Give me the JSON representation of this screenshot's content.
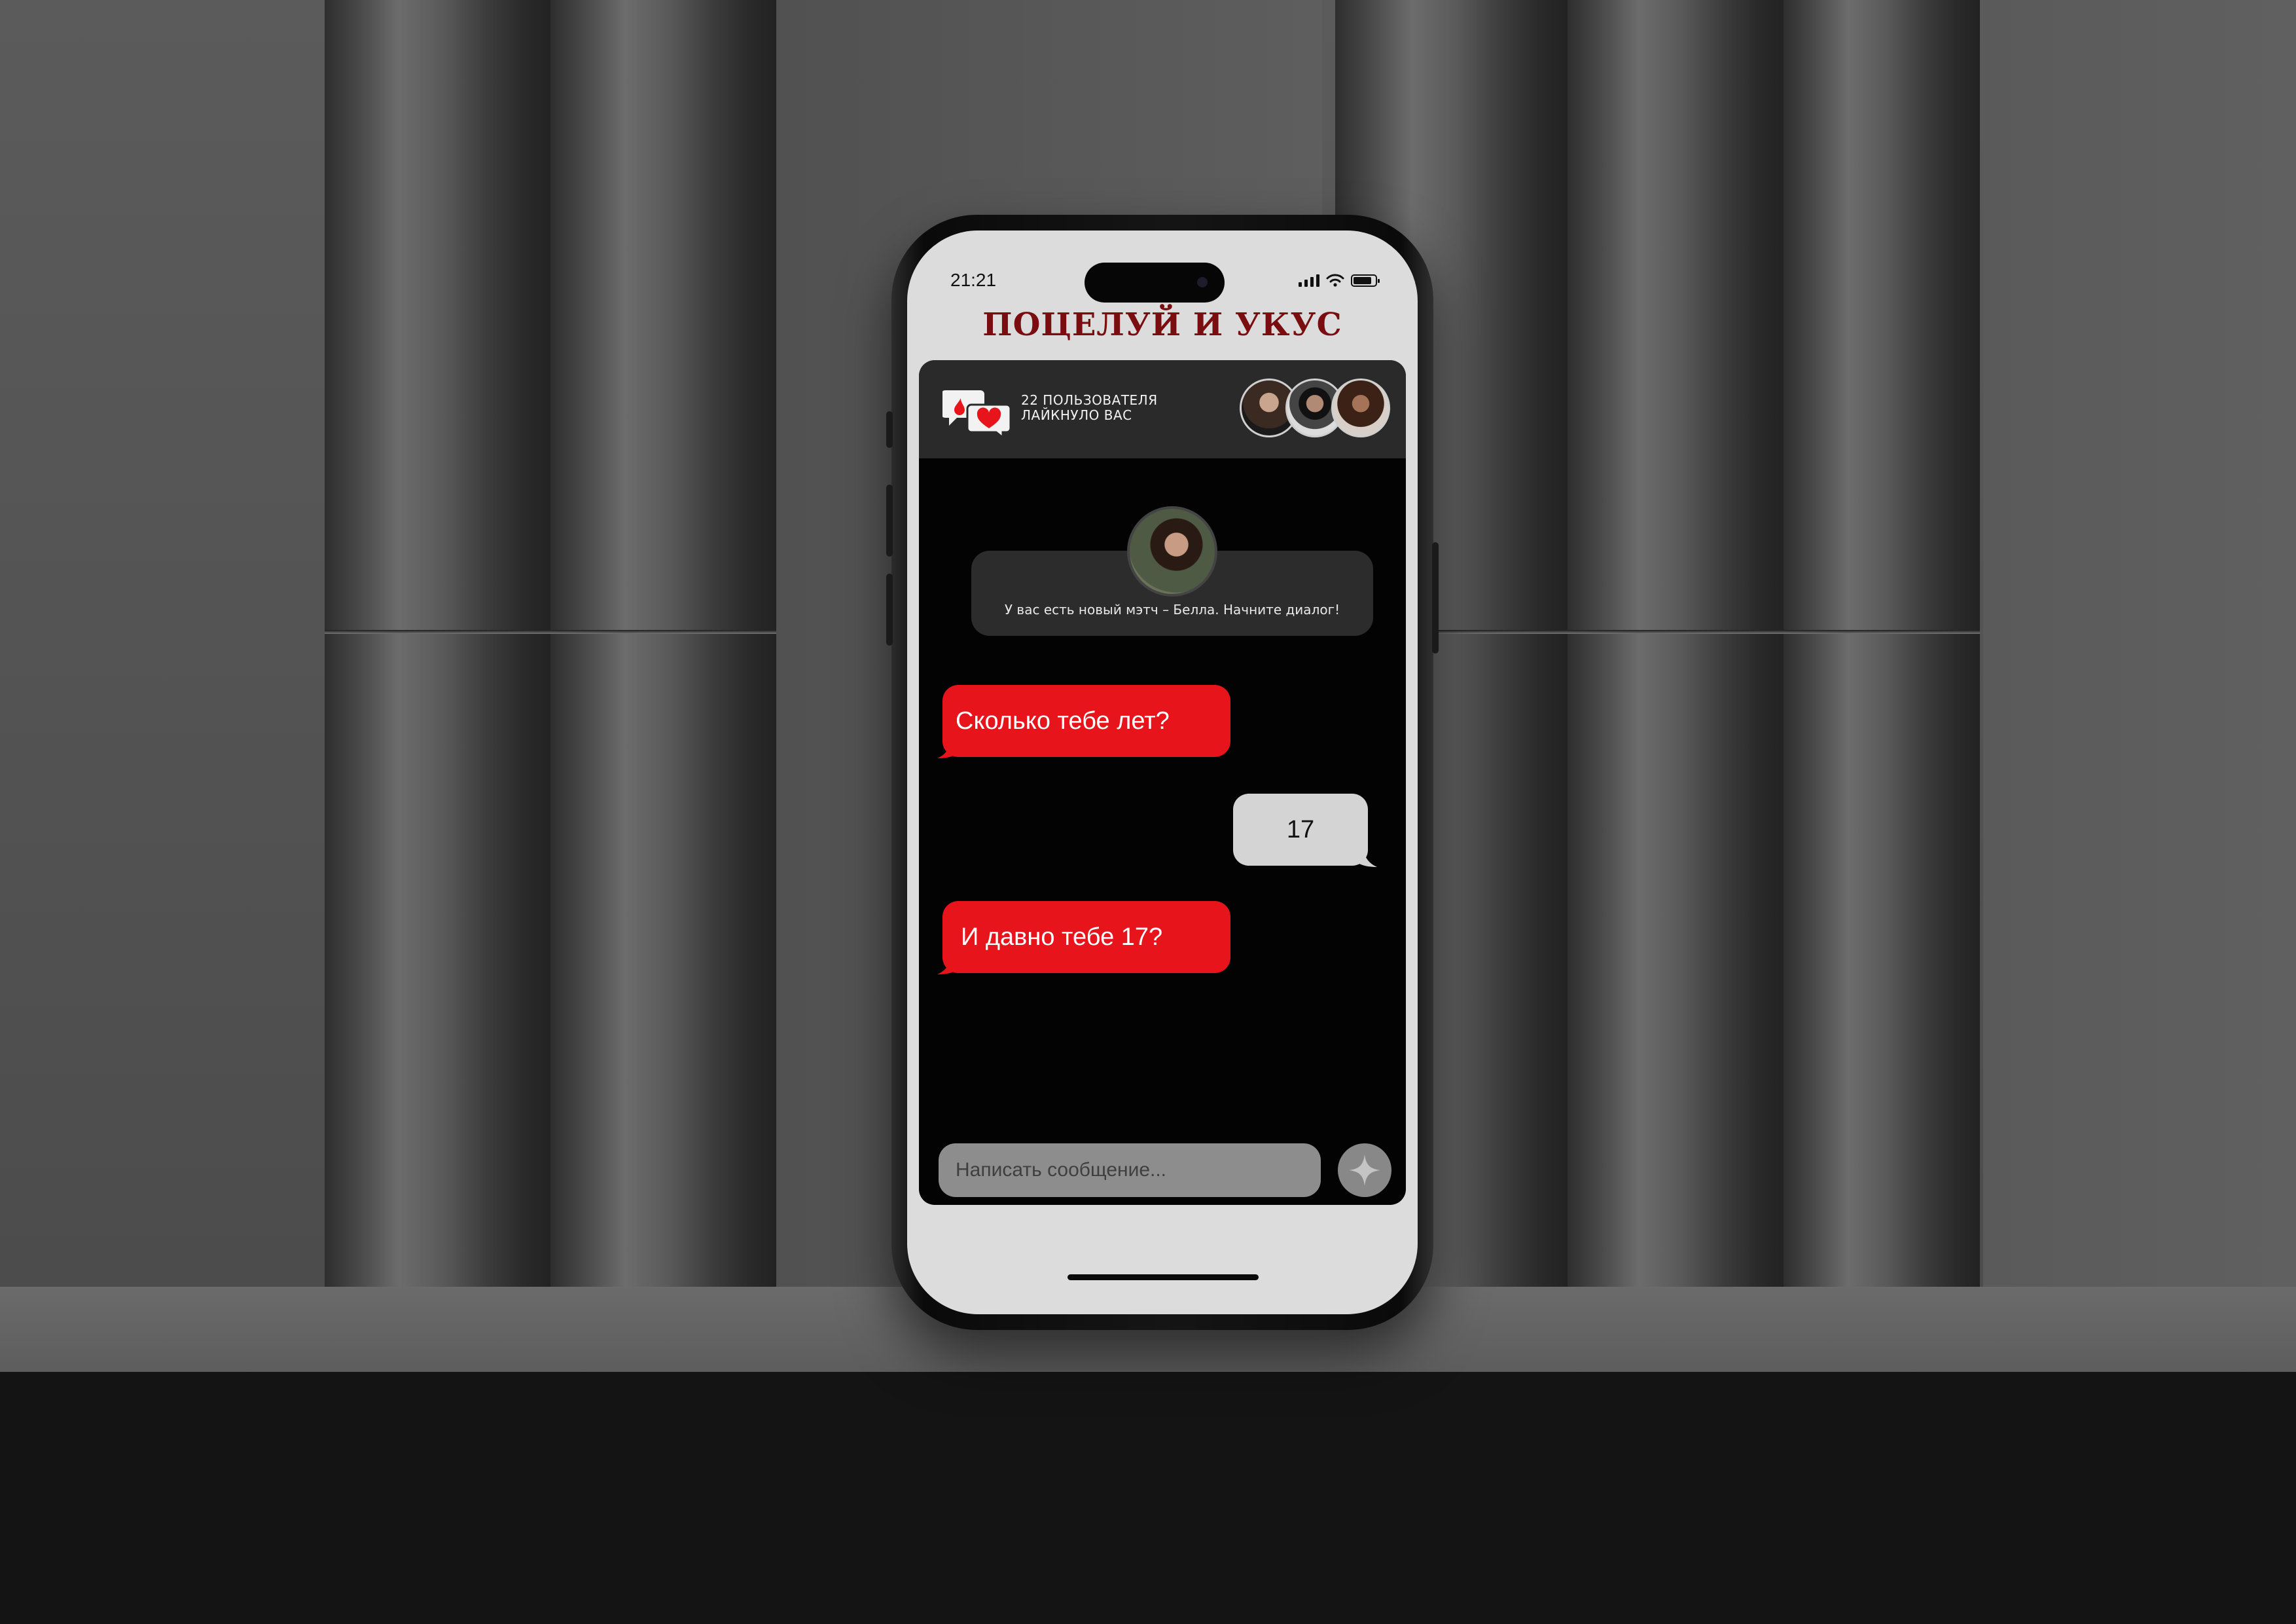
{
  "status_bar": {
    "time": "21:21"
  },
  "app": {
    "title": "Поцелуй и укус"
  },
  "likes_banner": {
    "text": "22 пользователя лайкнуло вас",
    "avatar_count": 3
  },
  "match_notice": {
    "text": "У вас есть новый мэтч – Белла. Начните диалог!"
  },
  "messages": [
    {
      "from": "them",
      "text": "Сколько тебе лет?"
    },
    {
      "from": "me",
      "text": "17"
    },
    {
      "from": "them",
      "text": "И давно тебе 17?"
    }
  ],
  "composer": {
    "placeholder": "Написать сообщение..."
  },
  "colors": {
    "accent_red": "#e8141c",
    "title_red": "#7a0d10",
    "screen_bg": "#dcdcdc",
    "chat_bg": "#030303"
  },
  "icons": {
    "likes": "hearts-chat-icon",
    "send": "sparkle-send-icon"
  }
}
